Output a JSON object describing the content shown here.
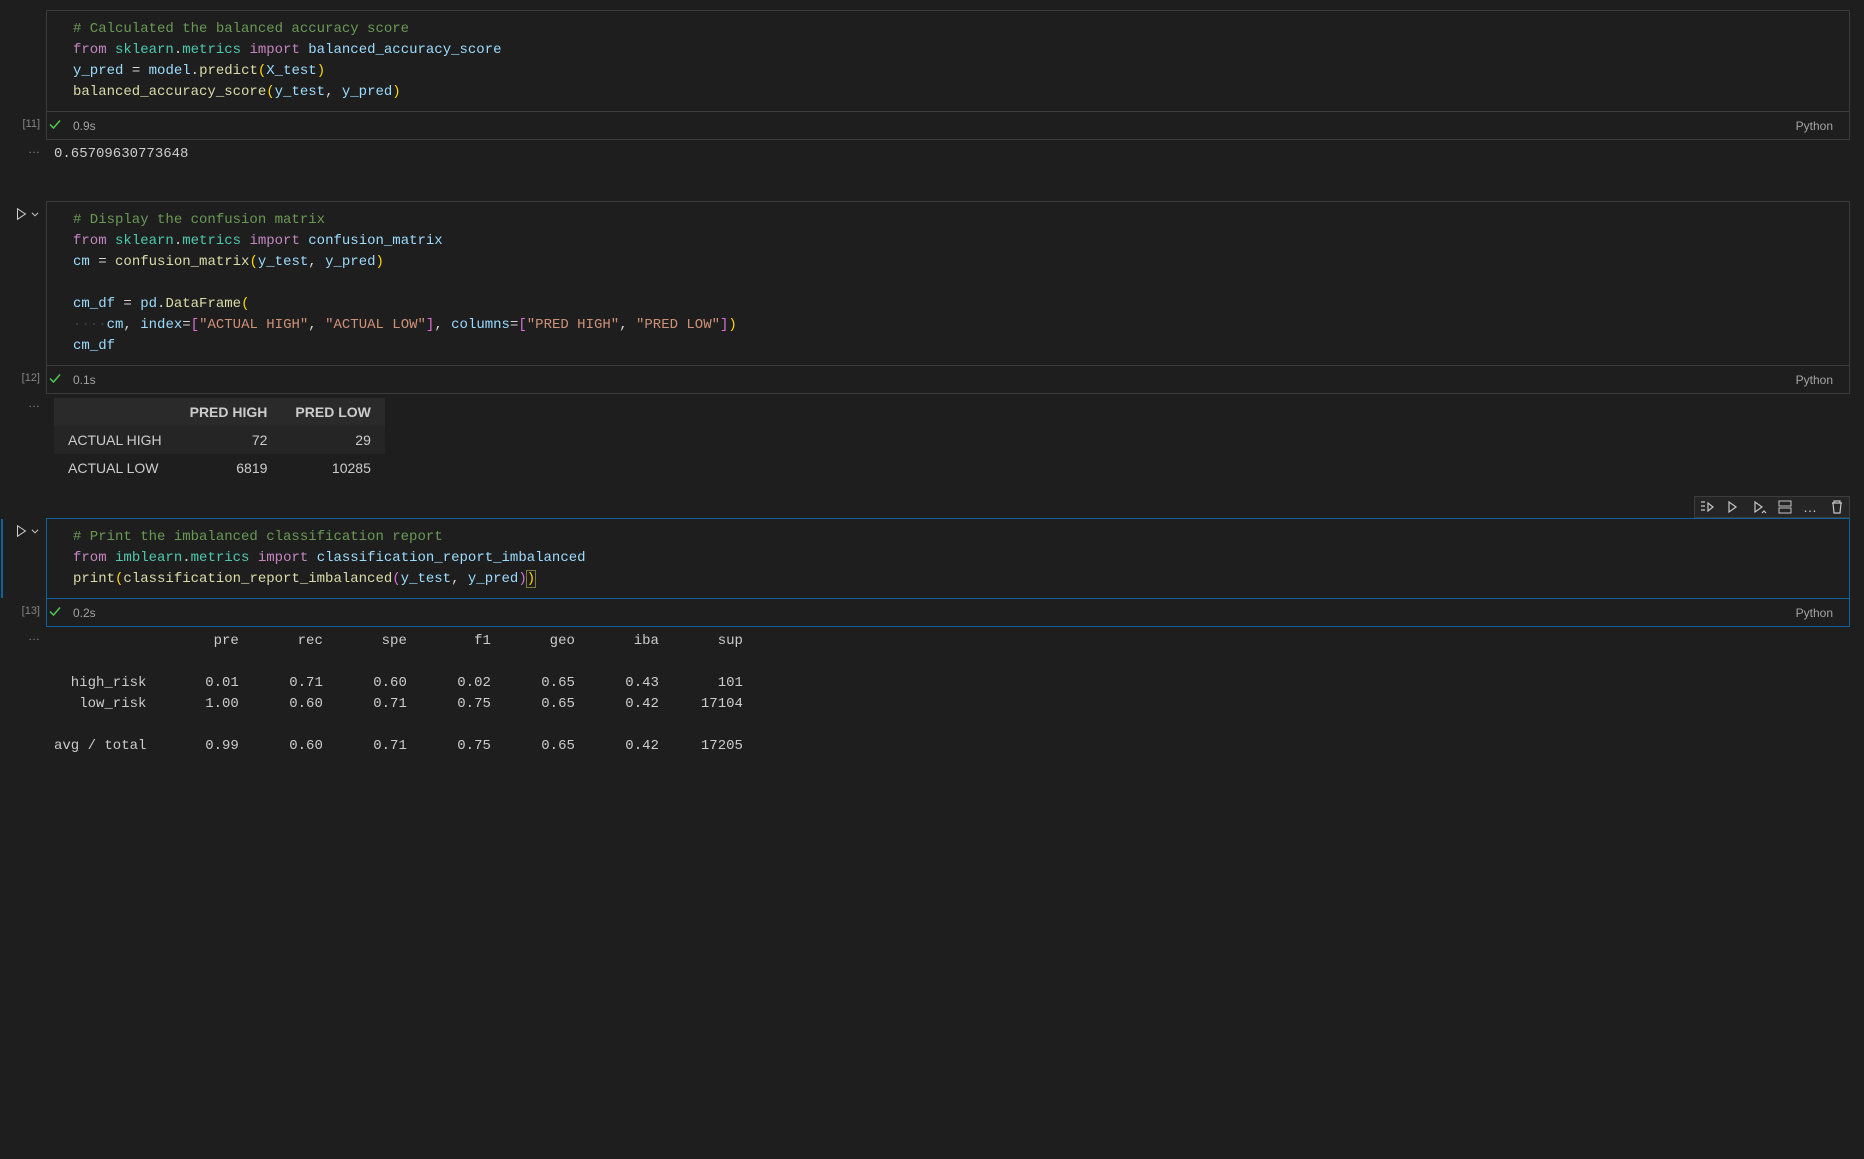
{
  "cells": {
    "c11": {
      "exec_count": "[11]",
      "exec_time": "0.9s",
      "lang": "Python",
      "code": {
        "l1_comment": "# Calculated the balanced accuracy score",
        "l2_from": "from",
        "l2_mod1": "sklearn",
        "l2_dot1": ".",
        "l2_mod2": "metrics",
        "l2_import": "import",
        "l2_name": "balanced_accuracy_score",
        "l3_var": "y_pred",
        "l3_eq": " = ",
        "l3_obj": "model",
        "l3_dot": ".",
        "l3_fn": "predict",
        "l3_lp": "(",
        "l3_arg": "X_test",
        "l3_rp": ")",
        "l4_fn": "balanced_accuracy_score",
        "l4_lp": "(",
        "l4_a1": "y_test",
        "l4_c": ", ",
        "l4_a2": "y_pred",
        "l4_rp": ")"
      },
      "output_ellipsis": "…",
      "output_value": "0.65709630773648"
    },
    "c12": {
      "exec_count": "[12]",
      "exec_time": "0.1s",
      "lang": "Python",
      "code": {
        "l1_comment": "# Display the confusion matrix",
        "l2_from": "from",
        "l2_mod1": "sklearn",
        "l2_dot1": ".",
        "l2_mod2": "metrics",
        "l2_import": "import",
        "l2_name": "confusion_matrix",
        "l3_var": "cm",
        "l3_eq": " = ",
        "l3_fn": "confusion_matrix",
        "l3_lp": "(",
        "l3_a1": "y_test",
        "l3_c": ", ",
        "l3_a2": "y_pred",
        "l3_rp": ")",
        "l5_var": "cm_df",
        "l5_eq": " = ",
        "l5_obj": "pd",
        "l5_dot": ".",
        "l5_fn": "DataFrame",
        "l5_lp": "(",
        "l6_ws": "····",
        "l6_a1": "cm",
        "l6_c1": ", ",
        "l6_kw1": "index",
        "l6_eq1": "=",
        "l6_lb1": "[",
        "l6_s1": "\"ACTUAL HIGH\"",
        "l6_c2": ", ",
        "l6_s2": "\"ACTUAL LOW\"",
        "l6_rb1": "]",
        "l6_c3": ", ",
        "l6_kw2": "columns",
        "l6_eq2": "=",
        "l6_lb2": "[",
        "l6_s3": "\"PRED HIGH\"",
        "l6_c4": ", ",
        "l6_s4": "\"PRED LOW\"",
        "l6_rb2": "]",
        "l6_rp": ")",
        "l7_var": "cm_df"
      },
      "output_ellipsis": "…",
      "table": {
        "cols": [
          "",
          "PRED HIGH",
          "PRED LOW"
        ],
        "rows": [
          [
            "ACTUAL HIGH",
            "72",
            "29"
          ],
          [
            "ACTUAL LOW",
            "6819",
            "10285"
          ]
        ]
      }
    },
    "c13": {
      "exec_count": "[13]",
      "exec_time": "0.2s",
      "lang": "Python",
      "code": {
        "l1_comment": "# Print the imbalanced classification report",
        "l2_from": "from",
        "l2_mod1": "imblearn",
        "l2_dot1": ".",
        "l2_mod2": "metrics",
        "l2_import": "import",
        "l2_name": "classification_report_imbalanced",
        "l3_fn": "print",
        "l3_lp": "(",
        "l3_fn2": "classification_report_imbalanced",
        "l3_lp2": "(",
        "l3_a1": "y_test",
        "l3_c": ", ",
        "l3_a2": "y_pred",
        "l3_rp2": ")",
        "l3_rp": ")"
      },
      "output_ellipsis": "…",
      "report": "                   pre       rec       spe        f1       geo       iba       sup\n\n  high_risk       0.01      0.71      0.60      0.02      0.65      0.43       101\n   low_risk       1.00      0.60      0.71      0.75      0.65      0.42     17104\n\navg / total       0.99      0.60      0.71      0.75      0.65      0.42     17205"
    }
  },
  "toolbar": {
    "run_line": "Run by line",
    "execute_above": "Execute above",
    "execute_below": "Execute below",
    "split": "Split cell",
    "more": "…",
    "delete": "Delete"
  },
  "chart_data": {
    "confusion_matrix": {
      "type": "table",
      "rows": [
        "ACTUAL HIGH",
        "ACTUAL LOW"
      ],
      "columns": [
        "PRED HIGH",
        "PRED LOW"
      ],
      "values": [
        [
          72,
          29
        ],
        [
          6819,
          10285
        ]
      ]
    },
    "classification_report": {
      "type": "table",
      "columns": [
        "pre",
        "rec",
        "spe",
        "f1",
        "geo",
        "iba",
        "sup"
      ],
      "rows": {
        "high_risk": [
          0.01,
          0.71,
          0.6,
          0.02,
          0.65,
          0.43,
          101
        ],
        "low_risk": [
          1.0,
          0.6,
          0.71,
          0.75,
          0.65,
          0.42,
          17104
        ],
        "avg / total": [
          0.99,
          0.6,
          0.71,
          0.75,
          0.65,
          0.42,
          17205
        ]
      }
    },
    "balanced_accuracy_score": 0.65709630773648
  }
}
